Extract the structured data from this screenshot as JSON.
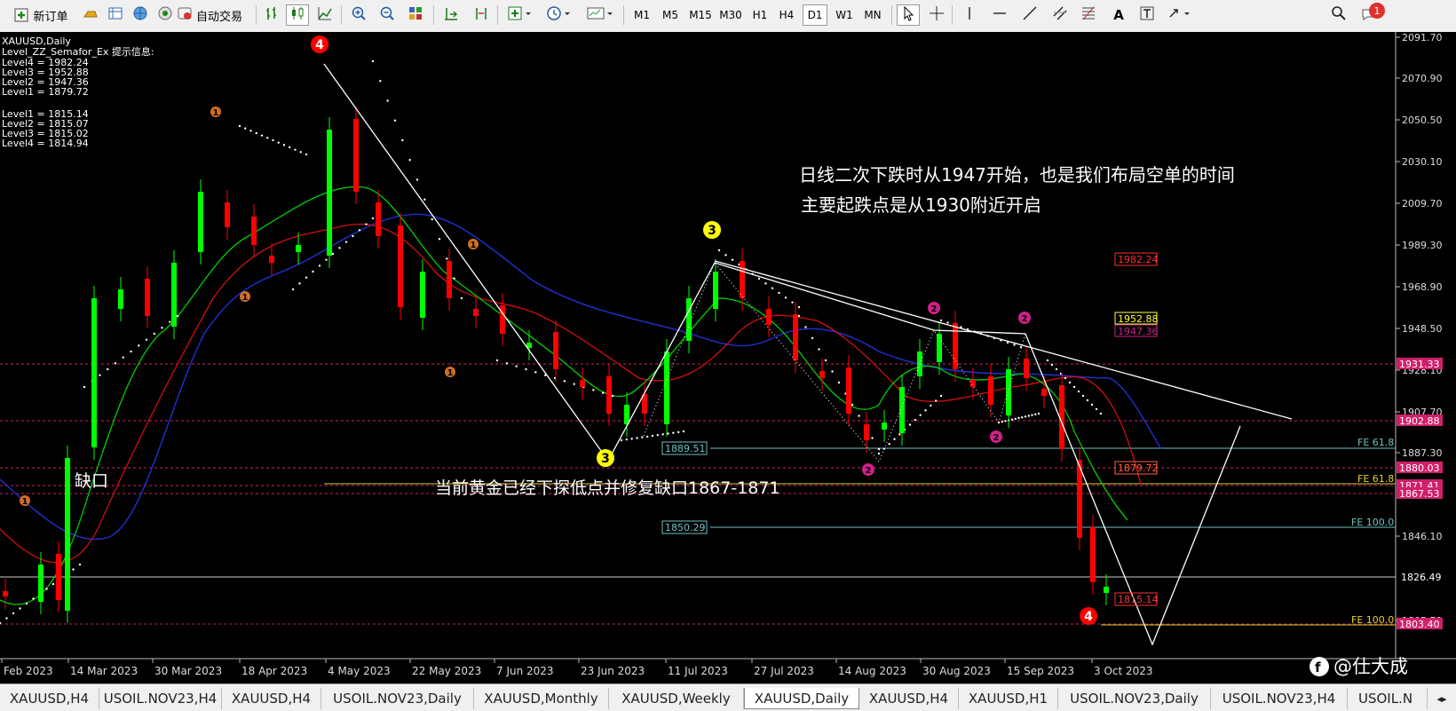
{
  "toolbar": {
    "new_order": "新订单",
    "auto_trade": "自动交易",
    "timeframes": [
      "M1",
      "M5",
      "M15",
      "M30",
      "H1",
      "H4",
      "D1",
      "W1",
      "MN"
    ],
    "active_timeframe": "D1",
    "notification_count": "1"
  },
  "chart": {
    "symbol": "XAUUSD,Daily",
    "indicator_title": "Level_ZZ_Semafor_Ex 提示信息:",
    "high_levels": [
      "Level4 = 1982.24",
      "Level3 = 1952.88",
      "Level2 = 1947.36",
      "Level1 = 1879.72"
    ],
    "low_levels": [
      "Level1 = 1815.14",
      "Level2 = 1815.07",
      "Level3 = 1815.02",
      "Level4 = 1814.94"
    ],
    "annotation_line1": "日线二次下跌时从1947开始，也是我们布局空单的时间",
    "annotation_line2": "主要起跌点是从1930附近开启",
    "gap_label": "缺口",
    "gap_note": "当前黄金已经下探低点并修复缺口1867-1871",
    "price_axis": [
      "2091.70",
      "2070.90",
      "2050.50",
      "2030.10",
      "2009.70",
      "1989.30",
      "1968.90",
      "1948.50",
      "1928.10",
      "1907.70",
      "1887.30",
      "1846.10",
      "1826.49",
      "1805.70"
    ],
    "price_axis_highlights": [
      {
        "label": "1931.33",
        "color": "#d0206a"
      },
      {
        "label": "1902.88",
        "color": "#d0206a"
      },
      {
        "label": "1880.03",
        "color": "#d0206a"
      },
      {
        "label": "1871.41",
        "color": "#d0206a"
      },
      {
        "label": "1867.53",
        "color": "#d0206a"
      },
      {
        "label": "1803.40",
        "color": "#d0206a"
      }
    ],
    "date_axis": [
      "Feb 2023",
      "14 Mar 2023",
      "30 Mar 2023",
      "18 Apr 2023",
      "4 May 2023",
      "22 May 2023",
      "7 Jun 2023",
      "23 Jun 2023",
      "11 Jul 2023",
      "27 Jul 2023",
      "14 Aug 2023",
      "30 Aug 2023",
      "15 Sep 2023",
      "3 Oct 2023"
    ],
    "level_boxes": [
      {
        "label": "1982.24",
        "color": "#ff3030"
      },
      {
        "label": "1952.88",
        "color": "#ffff40"
      },
      {
        "label": "1947.36",
        "color": "#d0208a"
      },
      {
        "label": "1879.72",
        "color": "#ff6040"
      },
      {
        "label": "1815.14",
        "color": "#ff3030"
      },
      {
        "label": "1889.51",
        "color": "#70c0c0"
      },
      {
        "label": "1850.29",
        "color": "#70c0c0"
      }
    ],
    "fe_labels": [
      "FE 61.8",
      "FE 61.8",
      "FE 100.0",
      "FE 100.0"
    ],
    "semafor_labels": [
      "4",
      "3",
      "3",
      "2",
      "2",
      "2",
      "2",
      "4",
      "1",
      "1",
      "1",
      "1",
      "1"
    ],
    "watermark": "@仕大成"
  },
  "tabs": [
    "XAUUSD,H4",
    "USOIL.NOV23,H4",
    "XAUUSD,H4",
    "USOIL.NOV23,Daily",
    "XAUUSD,Monthly",
    "XAUUSD,Weekly",
    "XAUUSD,Daily",
    "XAUUSD,H4",
    "XAUUSD,H1",
    "USOIL.NOV23,Daily",
    "USOIL.NOV23,H4",
    "USOIL.N"
  ],
  "active_tab": "XAUUSD,Daily",
  "colors": {
    "bull": "#00ff00",
    "bear": "#ff0000",
    "ma_fast": "#00d000",
    "ma_mid": "#d01010",
    "ma_slow": "#2030d0",
    "semafor_4": "#ff0000",
    "semafor_3": "#ffff00",
    "semafor_2": "#d0208a",
    "semafor_1": "#d07020"
  }
}
